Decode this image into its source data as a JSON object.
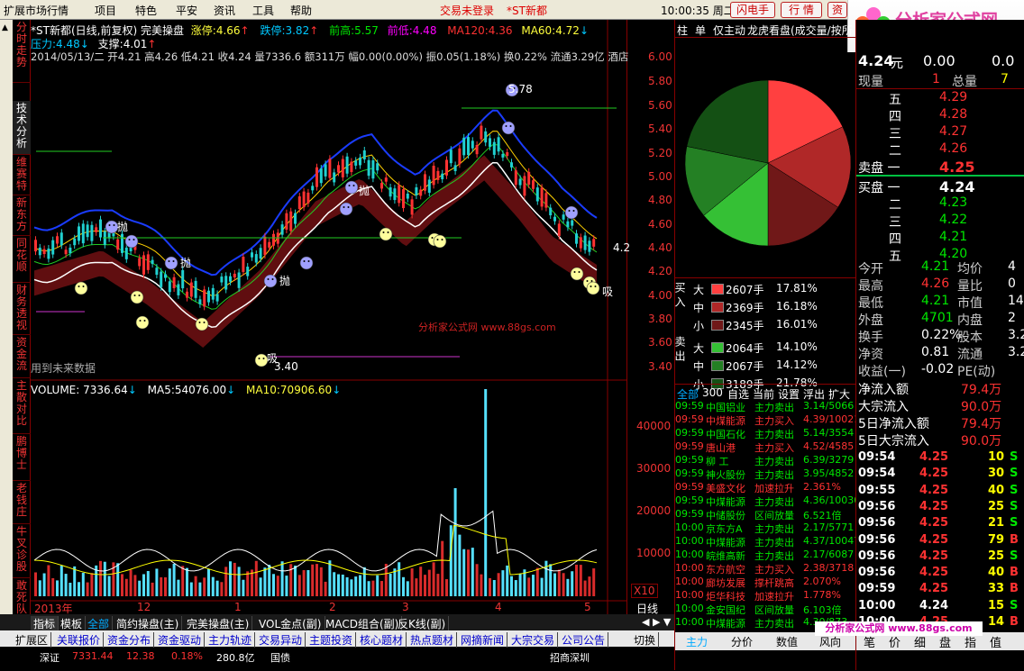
{
  "menubar": {
    "items": [
      "扩展市场行情",
      "项目",
      "特色",
      "平安",
      "资讯",
      "工具",
      "帮助"
    ],
    "login": "交易未登录",
    "stock": "*ST新都",
    "clock": "10:00:35 周二",
    "btn1": "闪电手",
    "btn2": "行 情",
    "btn3": "资"
  },
  "logo": {
    "cn": "分析家公式网",
    "url": "www.88gs.com"
  },
  "sidetabs": [
    "分时走势",
    "技术分析",
    "维赛特",
    "新东方",
    "同花顺",
    "财务透视",
    "资金流",
    "主散对比",
    "鹏博士",
    "老钱庄",
    "牛叉诊股",
    "敢死队"
  ],
  "chart": {
    "title": "*ST新都(日线,前复权) 完美操盘",
    "limit_up_label": "涨停:",
    "limit_up": "4.66",
    "limit_down_label": "跌停:",
    "limit_down": "3.82",
    "prev_high_label": "前高:",
    "prev_high": "5.57",
    "prev_low_label": "前低:",
    "prev_low": "4.48",
    "ma120_label": "MA120:",
    "ma120": "4.36",
    "ma60_label": "MA60:",
    "ma60": "4.72",
    "pressure_label": "压力:",
    "pressure": "4.48",
    "support_label": "支撑:",
    "support": "4.01",
    "ohlc_line": "2014/05/13/二 开4.21 高4.26 低4.21 收4.24 量7336.6 额311万 幅0.00(0.00%) 振0.05(1.18%) 换0.22% 流通3.29亿 酒店",
    "price_axis": [
      "6.00",
      "5.80",
      "5.60",
      "5.40",
      "5.20",
      "5.00",
      "4.80",
      "4.60",
      "4.40",
      "4.20",
      "4.00",
      "3.80",
      "3.60",
      "3.40"
    ],
    "high_mark": "5.78",
    "low_mark": "3.40",
    "cur_mark": "4.2",
    "future_note": "用到未来数据",
    "watermark": "分析家公式网 www.88gs.com",
    "signal_sell": "抛",
    "signal_buy": "吸"
  },
  "volume": {
    "vol_label": "VOLUME:",
    "vol": "7336.64",
    "ma5_label": "MA5:",
    "ma5": "54076.00",
    "ma10_label": "MA10:",
    "ma10": "70906.60",
    "axis": [
      "40000",
      "30000",
      "20000",
      "10000"
    ],
    "unit": "X10"
  },
  "xaxis": {
    "labels": [
      "2013年",
      "12",
      "1",
      "2",
      "3",
      "4",
      "5"
    ],
    "period": "日线"
  },
  "bottom_tabs": [
    "指标",
    "模板",
    "全部",
    "简约操盘(主)",
    "完美操盘(主)",
    "VOL金点(副)",
    "MACD组合(副)",
    "反K线(副)"
  ],
  "bottom_tabs2": [
    "扩展区",
    "关联报价",
    "资金分布",
    "资金驱动",
    "主力轨迹",
    "交易异动",
    "主题投资",
    "核心题材",
    "热点题材",
    "网摘新闻",
    "大宗交易",
    "公司公告"
  ],
  "bottom_right": {
    "switch": "切换"
  },
  "status_line": {
    "text1": "深证",
    "v1": "7331.44",
    "v2": "12.38",
    "v3": "0.18%",
    "v4": "280.8亿",
    "text2": "国债",
    "text3": "招商深圳"
  },
  "midpanel": {
    "tabs": [
      "柱",
      "单",
      "仅主动",
      "龙虎看盘(成交量/按所"
    ],
    "buy_rows": [
      {
        "size": "大",
        "vol": "2607手",
        "pct": "17.81%"
      },
      {
        "size": "中",
        "vol": "2369手",
        "pct": "16.18%"
      },
      {
        "size": "小",
        "vol": "2345手",
        "pct": "16.01%"
      }
    ],
    "sell_rows": [
      {
        "size": "大",
        "vol": "2064手",
        "pct": "14.10%"
      },
      {
        "size": "中",
        "vol": "2067手",
        "pct": "14.12%"
      },
      {
        "size": "小",
        "vol": "3189手",
        "pct": "21.78%"
      }
    ],
    "buy_label": "买 入",
    "sell_label": "卖 出",
    "pie": {
      "slices": [
        17.81,
        16.18,
        16.01,
        14.1,
        14.12,
        21.78
      ],
      "colors": [
        "#ff4040",
        "#b02828",
        "#701818",
        "#35c035",
        "#248024",
        "#145014"
      ]
    },
    "filters": [
      "全部",
      "300",
      "自选",
      "当前",
      "设置",
      "浮出",
      "扩大"
    ],
    "trades": [
      {
        "t": "09:59",
        "n": "中国铝业",
        "a": "主力卖出",
        "v": "3.14/5066",
        "c": "grn"
      },
      {
        "t": "09:59",
        "n": "中煤能源",
        "a": "主力买入",
        "v": "4.39/10021",
        "c": "red"
      },
      {
        "t": "09:59",
        "n": "中国石化",
        "a": "主力卖出",
        "v": "5.14/3554",
        "c": "grn"
      },
      {
        "t": "09:59",
        "n": "唐山港",
        "a": "主力买入",
        "v": "4.52/4585",
        "c": "red"
      },
      {
        "t": "09:59",
        "n": "柳  工",
        "a": "主力卖出",
        "v": "6.39/3279",
        "c": "grn"
      },
      {
        "t": "09:59",
        "n": "神火股份",
        "a": "主力卖出",
        "v": "3.95/4852",
        "c": "grn"
      },
      {
        "t": "09:59",
        "n": "美盛文化",
        "a": "加速拉升",
        "v": "2.361%",
        "c": "red"
      },
      {
        "t": "09:59",
        "n": "中煤能源",
        "a": "主力卖出",
        "v": "4.36/10030",
        "c": "grn"
      },
      {
        "t": "09:59",
        "n": "中储股份",
        "a": "区间放量",
        "v": "6.521倍",
        "c": "grn"
      },
      {
        "t": "10:00",
        "n": "京东方A",
        "a": "主力卖出",
        "v": "2.17/5771",
        "c": "grn"
      },
      {
        "t": "10:00",
        "n": "中煤能源",
        "a": "主力卖出",
        "v": "4.37/10047",
        "c": "grn"
      },
      {
        "t": "10:00",
        "n": "皖维高新",
        "a": "主力卖出",
        "v": "2.17/6087",
        "c": "grn"
      },
      {
        "t": "10:00",
        "n": "东方航空",
        "a": "主力买入",
        "v": "2.38/3718",
        "c": "red"
      },
      {
        "t": "10:00",
        "n": "廊坊发展",
        "a": "撑杆跳高",
        "v": "2.070%",
        "c": "red"
      },
      {
        "t": "10:00",
        "n": "炬华科技",
        "a": "加速拉升",
        "v": "1.778%",
        "c": "red"
      },
      {
        "t": "10:00",
        "n": "金安国纪",
        "a": "区间放量",
        "v": "6.103倍",
        "c": "grn"
      },
      {
        "t": "10:00",
        "n": "中煤能源",
        "a": "主力卖出",
        "v": "4.30/873",
        "c": "grn"
      }
    ],
    "bottom_tabs": [
      "主力",
      "分价",
      "数值",
      "风向"
    ]
  },
  "rightpanel": {
    "price": "4.24",
    "unit": "元",
    "change": "0.00",
    "change2": "0.0",
    "vol_now_label": "现量",
    "vol_now": "1",
    "total_label": "总量",
    "total": "7",
    "sells": [
      {
        "l": "五",
        "p": "4.29"
      },
      {
        "l": "四",
        "p": "4.28"
      },
      {
        "l": "三",
        "p": "4.27"
      },
      {
        "l": "二",
        "p": "4.26"
      },
      {
        "l": "卖盘 一",
        "p": "4.25"
      }
    ],
    "buys": [
      {
        "l": "买盘 一",
        "p": "4.24"
      },
      {
        "l": "二",
        "p": "4.23"
      },
      {
        "l": "三",
        "p": "4.22"
      },
      {
        "l": "四",
        "p": "4.21"
      },
      {
        "l": "五",
        "p": "4.20"
      }
    ],
    "stats": [
      {
        "a": "今开",
        "b": "4.21",
        "c": "均价",
        "d": "4"
      },
      {
        "a": "最高",
        "b": "4.26",
        "c": "量比",
        "d": "0"
      },
      {
        "a": "最低",
        "b": "4.21",
        "c": "市值",
        "d": "14."
      },
      {
        "a": "外盘",
        "b": "4701",
        "c": "内盘",
        "d": "2"
      },
      {
        "a": "换手",
        "b": "0.22%",
        "c": "股本",
        "d": "3.2"
      },
      {
        "a": "净资",
        "b": "0.81",
        "c": "流通",
        "d": "3.2"
      },
      {
        "a": "收益(一)",
        "b": "-0.02",
        "c": "PE(动)",
        "d": ""
      }
    ],
    "flows": [
      {
        "l": "净流入额",
        "v": "79.4万"
      },
      {
        "l": "大宗流入",
        "v": "90.0万"
      },
      {
        "l": "5日净流入额",
        "v": "79.4万"
      },
      {
        "l": "5日大宗流入",
        "v": "90.0万"
      }
    ],
    "ticks": [
      {
        "t": "09:54",
        "p": "4.25",
        "v": "10",
        "s": "S"
      },
      {
        "t": "09:54",
        "p": "4.25",
        "v": "30",
        "s": "S"
      },
      {
        "t": "09:55",
        "p": "4.25",
        "v": "40",
        "s": "S"
      },
      {
        "t": "09:56",
        "p": "4.25",
        "v": "25",
        "s": "S"
      },
      {
        "t": "09:56",
        "p": "4.25",
        "v": "21",
        "s": "S"
      },
      {
        "t": "09:56",
        "p": "4.25",
        "v": "79",
        "s": "B"
      },
      {
        "t": "09:56",
        "p": "4.25",
        "v": "25",
        "s": "S"
      },
      {
        "t": "09:56",
        "p": "4.25",
        "v": "40",
        "s": "B"
      },
      {
        "t": "09:59",
        "p": "4.25",
        "v": "33",
        "s": "B"
      },
      {
        "t": "10:00",
        "p": "4.24",
        "v": "15",
        "s": "S"
      },
      {
        "t": "10:00",
        "p": "4.25",
        "v": "14",
        "s": "B"
      }
    ],
    "bottom_tabs": [
      "笔",
      "价",
      "细",
      "盘",
      "指",
      "值"
    ]
  }
}
